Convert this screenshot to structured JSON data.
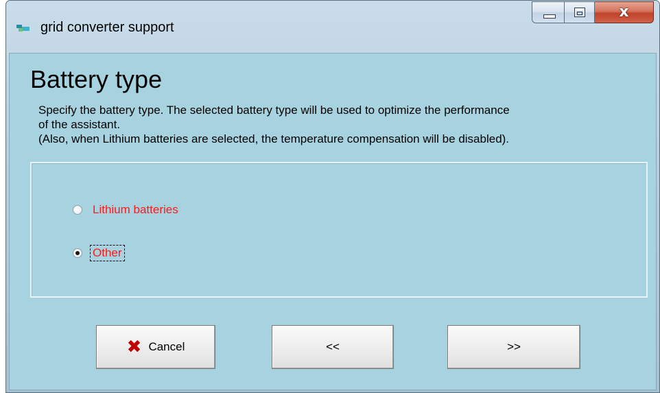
{
  "window": {
    "title": "grid converter support",
    "icon": "app-icon",
    "close_glyph": "x"
  },
  "page": {
    "heading": "Battery type",
    "description_lines": [
      "Specify the battery type. The selected battery type will be used to optimize the performance",
      "of the assistant.",
      "(Also, when Lithium batteries are selected, the temperature compensation will be disabled)."
    ]
  },
  "options": [
    {
      "label": "Lithium batteries",
      "checked": false
    },
    {
      "label": "Other",
      "checked": true
    }
  ],
  "buttons": {
    "cancel": "Cancel",
    "back": "<<",
    "next": ">>"
  },
  "colors": {
    "client_background": "#a7d3e1",
    "option_label": "#ff1a1a",
    "cancel_icon": "#c00000"
  }
}
